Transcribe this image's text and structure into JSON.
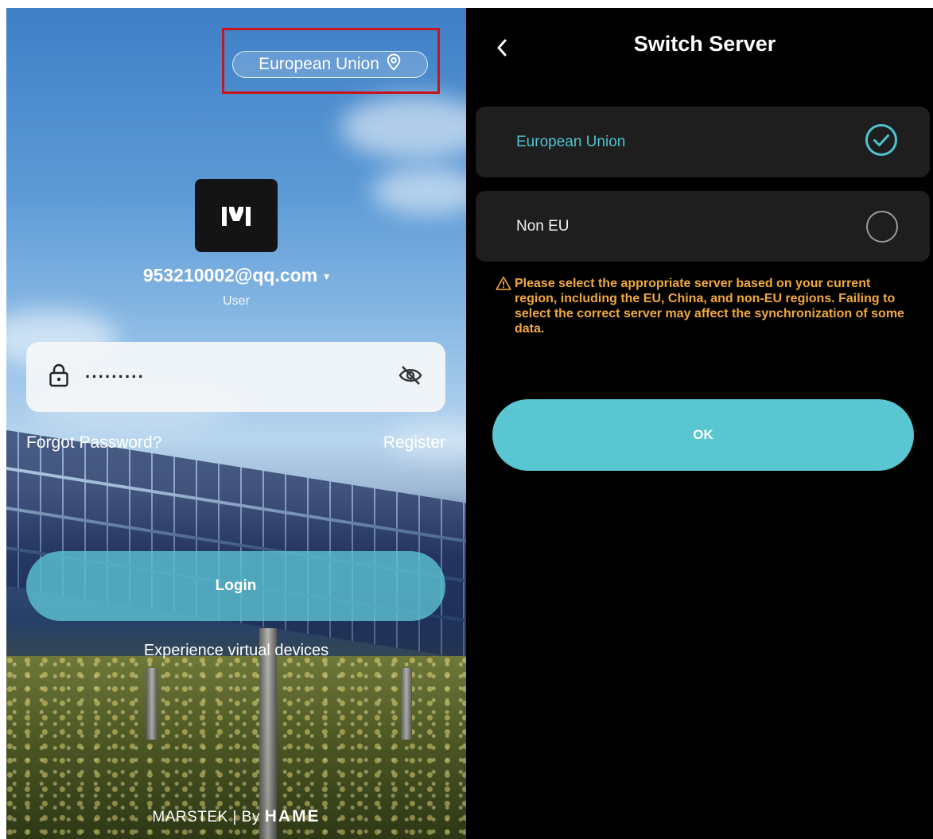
{
  "login_screen": {
    "region": "European Union",
    "account": "953210002@qq.com",
    "role": "User",
    "password_masked": "·········",
    "forgot_password": "Forgot Password?",
    "register": "Register",
    "login_button": "Login",
    "virtual_devices": "Experience virtual devices",
    "brand_marstek": "MARSTEK",
    "brand_separator": "|",
    "brand_by": "By",
    "brand_hame": "HAME"
  },
  "switch_server": {
    "title": "Switch Server",
    "options": [
      {
        "label": "European Union",
        "selected": true
      },
      {
        "label": "Non EU",
        "selected": false
      }
    ],
    "warning": "Please select the appropriate server based on your current region, including the EU, China, and non-EU regions. Failing to select the correct server may affect the synchronization of some data.",
    "ok_button": "OK"
  },
  "colors": {
    "accent": "#5ac6d2",
    "selected_text": "#4fc2cf",
    "warning": "#f2a93b",
    "highlight_box": "#c8141a"
  },
  "icons": [
    "location-icon",
    "lock-icon",
    "eye-off-icon",
    "back-icon",
    "check-circle-icon",
    "warning-icon",
    "marstek-logo"
  ]
}
